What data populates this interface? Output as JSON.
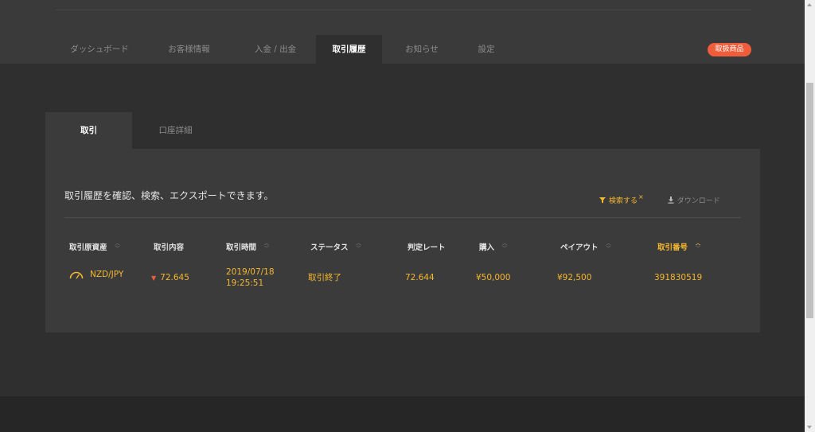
{
  "nav": {
    "tabs": [
      {
        "label": "ダッシュボード"
      },
      {
        "label": "お客様情報"
      },
      {
        "label": "入金 / 出金"
      },
      {
        "label": "取引履歴"
      },
      {
        "label": "お知らせ"
      },
      {
        "label": "設定"
      }
    ],
    "active_index": 3,
    "products_button": "取扱商品"
  },
  "panel_tabs": [
    {
      "label": "取引"
    },
    {
      "label": "口座詳細"
    }
  ],
  "panel": {
    "description": "取引履歴を確認、検索、エクスポートできます。",
    "search_label": "検索する",
    "search_clear": "×",
    "download_label": "ダウンロード"
  },
  "table": {
    "headers": [
      "取引原資産",
      "取引内容",
      "取引時間",
      "ステータス",
      "判定レート",
      "購入",
      "ペイアウト",
      "取引番号"
    ],
    "rows": [
      {
        "asset": "NZD/JPY",
        "content": "72.645",
        "date": "2019/07/18",
        "time": "19:25:51",
        "status": "取引終了",
        "rate": "72.644",
        "purchase": "¥50,000",
        "payout": "¥92,500",
        "trade_no": "391830519"
      }
    ]
  },
  "colors": {
    "accent": "#f5b830",
    "badge": "#f05d3b",
    "background": "#2f2f2f",
    "panel": "#3b3b3b"
  }
}
